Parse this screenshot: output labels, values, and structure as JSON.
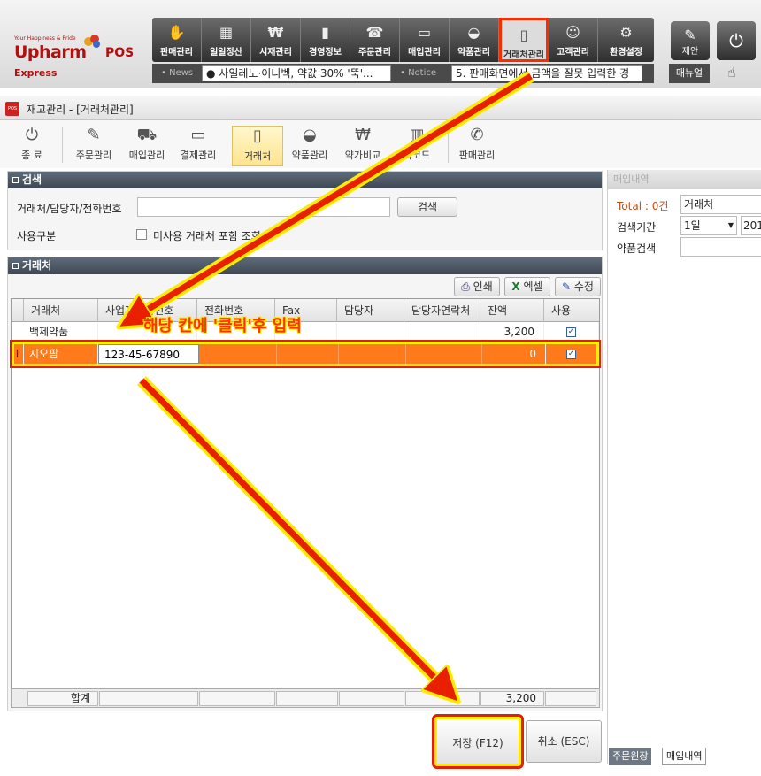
{
  "app": {
    "logo_tagline": "Your Happiness & Pride",
    "logo_brand": "Upharm",
    "logo_pos": "POS",
    "logo_express": "Express"
  },
  "top_menu": [
    {
      "label": "판매관리",
      "icon": "hand-coins-icon"
    },
    {
      "label": "일일정산",
      "icon": "calculator-icon"
    },
    {
      "label": "시재관리",
      "icon": "money-bag-icon"
    },
    {
      "label": "경영정보",
      "icon": "chart-icon"
    },
    {
      "label": "주문관리",
      "icon": "phone-icon"
    },
    {
      "label": "매입관리",
      "icon": "truck-icon"
    },
    {
      "label": "약품관리",
      "icon": "mortar-icon"
    },
    {
      "label": "거래처관리",
      "icon": "mobile-icon"
    },
    {
      "label": "고객관리",
      "icon": "customer-icon"
    },
    {
      "label": "환경설정",
      "icon": "gear-icon"
    }
  ],
  "side_buttons": {
    "suggest": "제안",
    "manual": "매뉴얼"
  },
  "news": {
    "label": "News",
    "text": "● 사일레노·이니벡, 약값 30% '뚝'...",
    "notice_label": "Notice",
    "notice_text": "5. 판매화면에서 금액을 잘못 입력한 경"
  },
  "window": {
    "title": "재고관리 - [거래처관리]"
  },
  "toolbar": [
    {
      "label": "종 료",
      "icon": "power-icon"
    },
    {
      "label": "주문관리",
      "icon": "order-icon"
    },
    {
      "label": "매입관리",
      "icon": "car-icon"
    },
    {
      "label": "결제관리",
      "icon": "card-icon"
    },
    {
      "label": "거래처",
      "icon": "mobile-icon"
    },
    {
      "label": "약품관리",
      "icon": "mortar-icon"
    },
    {
      "label": "약가비교",
      "icon": "won-compare-icon"
    },
    {
      "label": "바코드",
      "icon": "barcode-icon"
    },
    {
      "label": "판매관리",
      "icon": "sale-icon"
    }
  ],
  "search": {
    "header": "검색",
    "field_label": "거래처/담당자/전화번호",
    "field_value": "",
    "search_button": "검색",
    "usage_label": "사용구분",
    "unused_checkbox": "미사용 거래처 포함 조회",
    "unused_checked": false
  },
  "vendors": {
    "header": "거래처",
    "print_button": "인쇄",
    "excel_button": "엑셀",
    "edit_button": "수정",
    "columns": [
      "거래처",
      "사업자등록번호",
      "전화번호",
      "Fax",
      "담당자",
      "담당자연락처",
      "잔액",
      "사용"
    ],
    "rows": [
      {
        "name": "백제약품",
        "bizno": "",
        "phone": "",
        "fax": "",
        "manager": "",
        "manager_phone": "",
        "balance": "3,200",
        "use": "✓"
      },
      {
        "name": "지오팜",
        "bizno": "123-45-67890",
        "phone": "",
        "fax": "",
        "manager": "",
        "manager_phone": "",
        "balance": "0",
        "use": "✓"
      }
    ],
    "footer_label": "합계",
    "footer_balance": "3,200"
  },
  "actions": {
    "save": "저장 (F12)",
    "cancel": "취소 (ESC)"
  },
  "purchase_panel": {
    "header": "매입내역",
    "total": "Total : 0건",
    "vendor_value": "거래처",
    "period_label": "검색기간",
    "period_value": "1일",
    "date_value": "201",
    "drug_label": "약품검색",
    "tabs": [
      "주문원장",
      "매입내역"
    ]
  },
  "annotation": {
    "text": "해당 칸에 '클릭'후 입력"
  },
  "colors": {
    "highlight_row": "#ff7a1a",
    "annotation_red": "#ff3300",
    "annotation_yellow": "#ffea00",
    "section_header": "#4a5562"
  }
}
